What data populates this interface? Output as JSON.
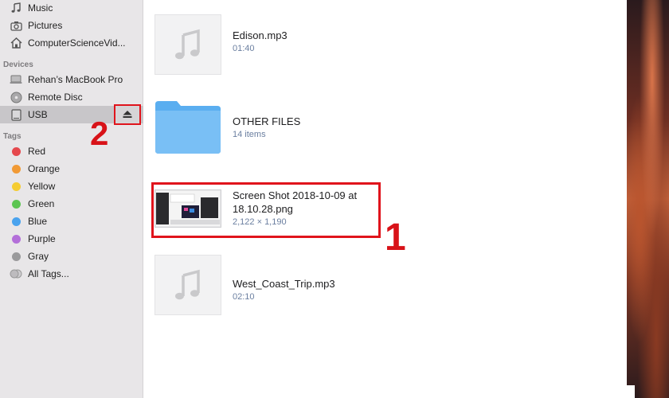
{
  "sidebar": {
    "favorites": [
      {
        "label": "Music",
        "icon": "music-note-icon"
      },
      {
        "label": "Pictures",
        "icon": "camera-icon"
      },
      {
        "label": "ComputerScienceVid...",
        "icon": "home-icon"
      }
    ],
    "devices_header": "Devices",
    "devices": [
      {
        "label": "Rehan’s MacBook Pro",
        "icon": "laptop-icon"
      },
      {
        "label": "Remote Disc",
        "icon": "disc-icon"
      },
      {
        "label": "USB",
        "icon": "drive-icon",
        "selected": true
      }
    ],
    "tags_header": "Tags",
    "tags": [
      {
        "label": "Red",
        "color": "#e5484d"
      },
      {
        "label": "Orange",
        "color": "#f19a35"
      },
      {
        "label": "Yellow",
        "color": "#f5cc32"
      },
      {
        "label": "Green",
        "color": "#5cc552"
      },
      {
        "label": "Blue",
        "color": "#4aa3ee"
      },
      {
        "label": "Purple",
        "color": "#b36fd9"
      },
      {
        "label": "Gray",
        "color": "#9a9a9c"
      }
    ],
    "all_tags": "All Tags..."
  },
  "annotations": {
    "eject_callout": "2",
    "file_callout": "1",
    "highlight_color": "#e0141c"
  },
  "files": [
    {
      "name": "Edison.mp3",
      "meta": "01:40",
      "kind": "audio"
    },
    {
      "name": "OTHER FILES",
      "meta": "14 items",
      "kind": "folder"
    },
    {
      "name_line1": "Screen Shot 2018-10-09 at",
      "name_line2": "18.10.28.png",
      "meta": "2,122 × 1,190",
      "kind": "image"
    },
    {
      "name": "West_Coast_Trip.mp3",
      "meta": "02:10",
      "kind": "audio"
    }
  ]
}
